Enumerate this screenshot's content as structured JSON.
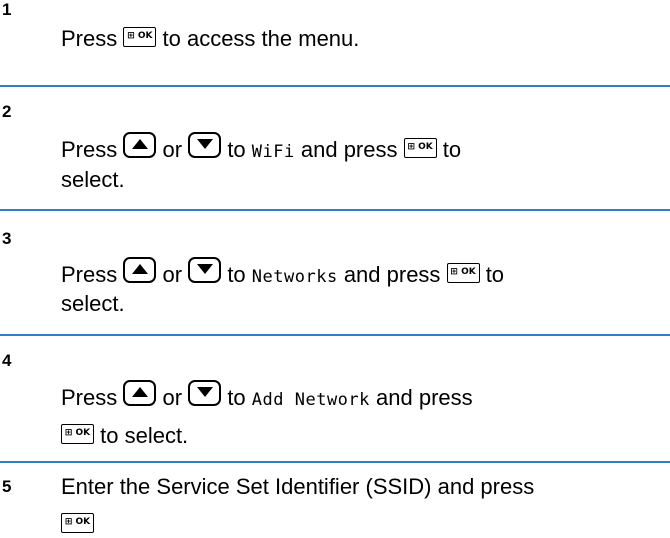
{
  "steps": [
    {
      "number": "1",
      "parts": {
        "a": "Press",
        "b": "to access the menu."
      }
    },
    {
      "number": "2",
      "parts": {
        "a": "Press",
        "b": "or",
        "c": "to",
        "code": "WiFi",
        "d": "and press",
        "e": "to",
        "f": "select."
      }
    },
    {
      "number": "3",
      "parts": {
        "a": "Press",
        "b": "or",
        "c": "to",
        "code": "Networks",
        "d": "and press",
        "e": "to",
        "f": "select."
      }
    },
    {
      "number": "4",
      "parts": {
        "a": "Press",
        "b": "or",
        "c": "to",
        "code": "Add Network",
        "d": "and press",
        "e": "to select."
      }
    },
    {
      "number": "5",
      "parts": {
        "a": "Enter the Service Set Identifier (SSID) and press"
      }
    }
  ],
  "keys": {
    "ok": "⊞ OK",
    "up": "up-arrow-icon",
    "down": "down-arrow-icon"
  },
  "colors": {
    "separator": "#2f7fc4",
    "text": "#000000"
  }
}
